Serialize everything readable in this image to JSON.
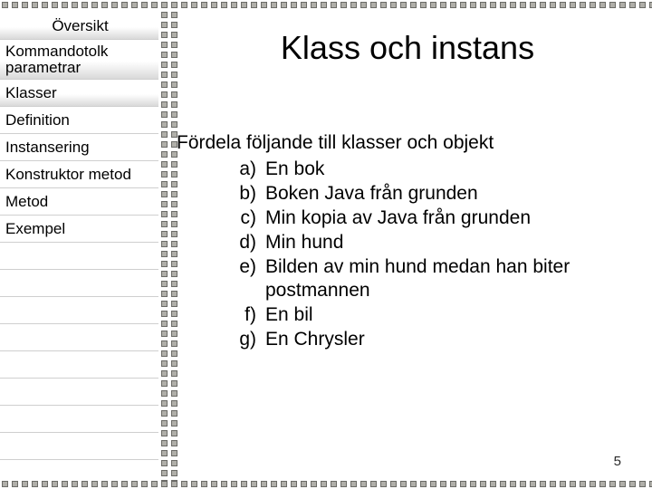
{
  "sidebar": {
    "header": "Översikt",
    "items": [
      "Kommandotolk parametrar",
      "Klasser",
      "Definition",
      "Instansering",
      "Konstruktor metod",
      "Metod",
      "Exempel"
    ]
  },
  "main": {
    "title": "Klass och instans",
    "prompt": "Fördela följande till klasser och objekt",
    "list": [
      {
        "label": "a)",
        "text": "En bok"
      },
      {
        "label": "b)",
        "text": "Boken Java från grunden"
      },
      {
        "label": "c)",
        "text": "Min kopia av Java från grunden"
      },
      {
        "label": "d)",
        "text": "Min hund"
      },
      {
        "label": "e)",
        "text": "Bilden av min hund medan han biter postmannen"
      },
      {
        "label": "f)",
        "text": "En bil"
      },
      {
        "label": "g)",
        "text": "En Chrysler"
      }
    ]
  },
  "page_number": "5"
}
